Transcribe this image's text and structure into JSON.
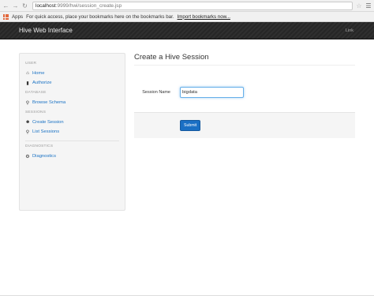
{
  "browser": {
    "url_host": "localhost",
    "url_path": ":9999/hwi/session_create.jsp",
    "bookmarks_apps": "Apps",
    "bookmarks_text": "For quick access, place your bookmarks here on the bookmarks bar.",
    "bookmarks_link": "Import bookmarks now..."
  },
  "navbar": {
    "brand": "Hive Web Interface",
    "link": "Link"
  },
  "sidebar": {
    "sections": [
      {
        "header": "USER",
        "items": [
          {
            "label": "Home",
            "icon": "home-icon"
          },
          {
            "label": "Authorize",
            "icon": "lock-icon"
          }
        ]
      },
      {
        "header": "DATABASE",
        "items": [
          {
            "label": "Browse Schema",
            "icon": "search-icon"
          }
        ]
      },
      {
        "header": "SESSIONS",
        "items": [
          {
            "label": "Create Session",
            "icon": "user-icon"
          },
          {
            "label": "List Sessions",
            "icon": "search-icon"
          }
        ]
      },
      {
        "header": "DIAGNOSTICS",
        "items": [
          {
            "label": "Diagnostics",
            "icon": "cog-icon"
          }
        ]
      }
    ]
  },
  "main": {
    "title": "Create a Hive Session",
    "session_label": "Session Name",
    "session_value": "bigdata",
    "submit_label": "Submit"
  }
}
